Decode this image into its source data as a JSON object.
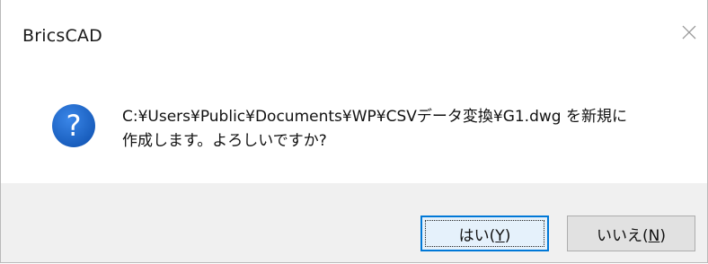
{
  "window": {
    "title": "BricsCAD",
    "close_icon": "close-icon"
  },
  "message": {
    "icon": "question-icon",
    "line1": "C:¥Users¥Public¥Documents¥WP¥CSVデータ変換¥G1.dwg を新規に",
    "line2": "作成します。よろしいですか?"
  },
  "buttons": {
    "yes_label": "はい(Y)",
    "yes_label_prefix": "はい(",
    "yes_accel": "Y",
    "yes_label_suffix": ")",
    "no_label": "いいえ(N)",
    "no_label_prefix": "いいえ(",
    "no_accel": "N",
    "no_label_suffix": ")"
  },
  "colors": {
    "accent": "#0078d7",
    "icon_blue": "#1f64c8",
    "footer_bg": "#f0f0f0"
  }
}
